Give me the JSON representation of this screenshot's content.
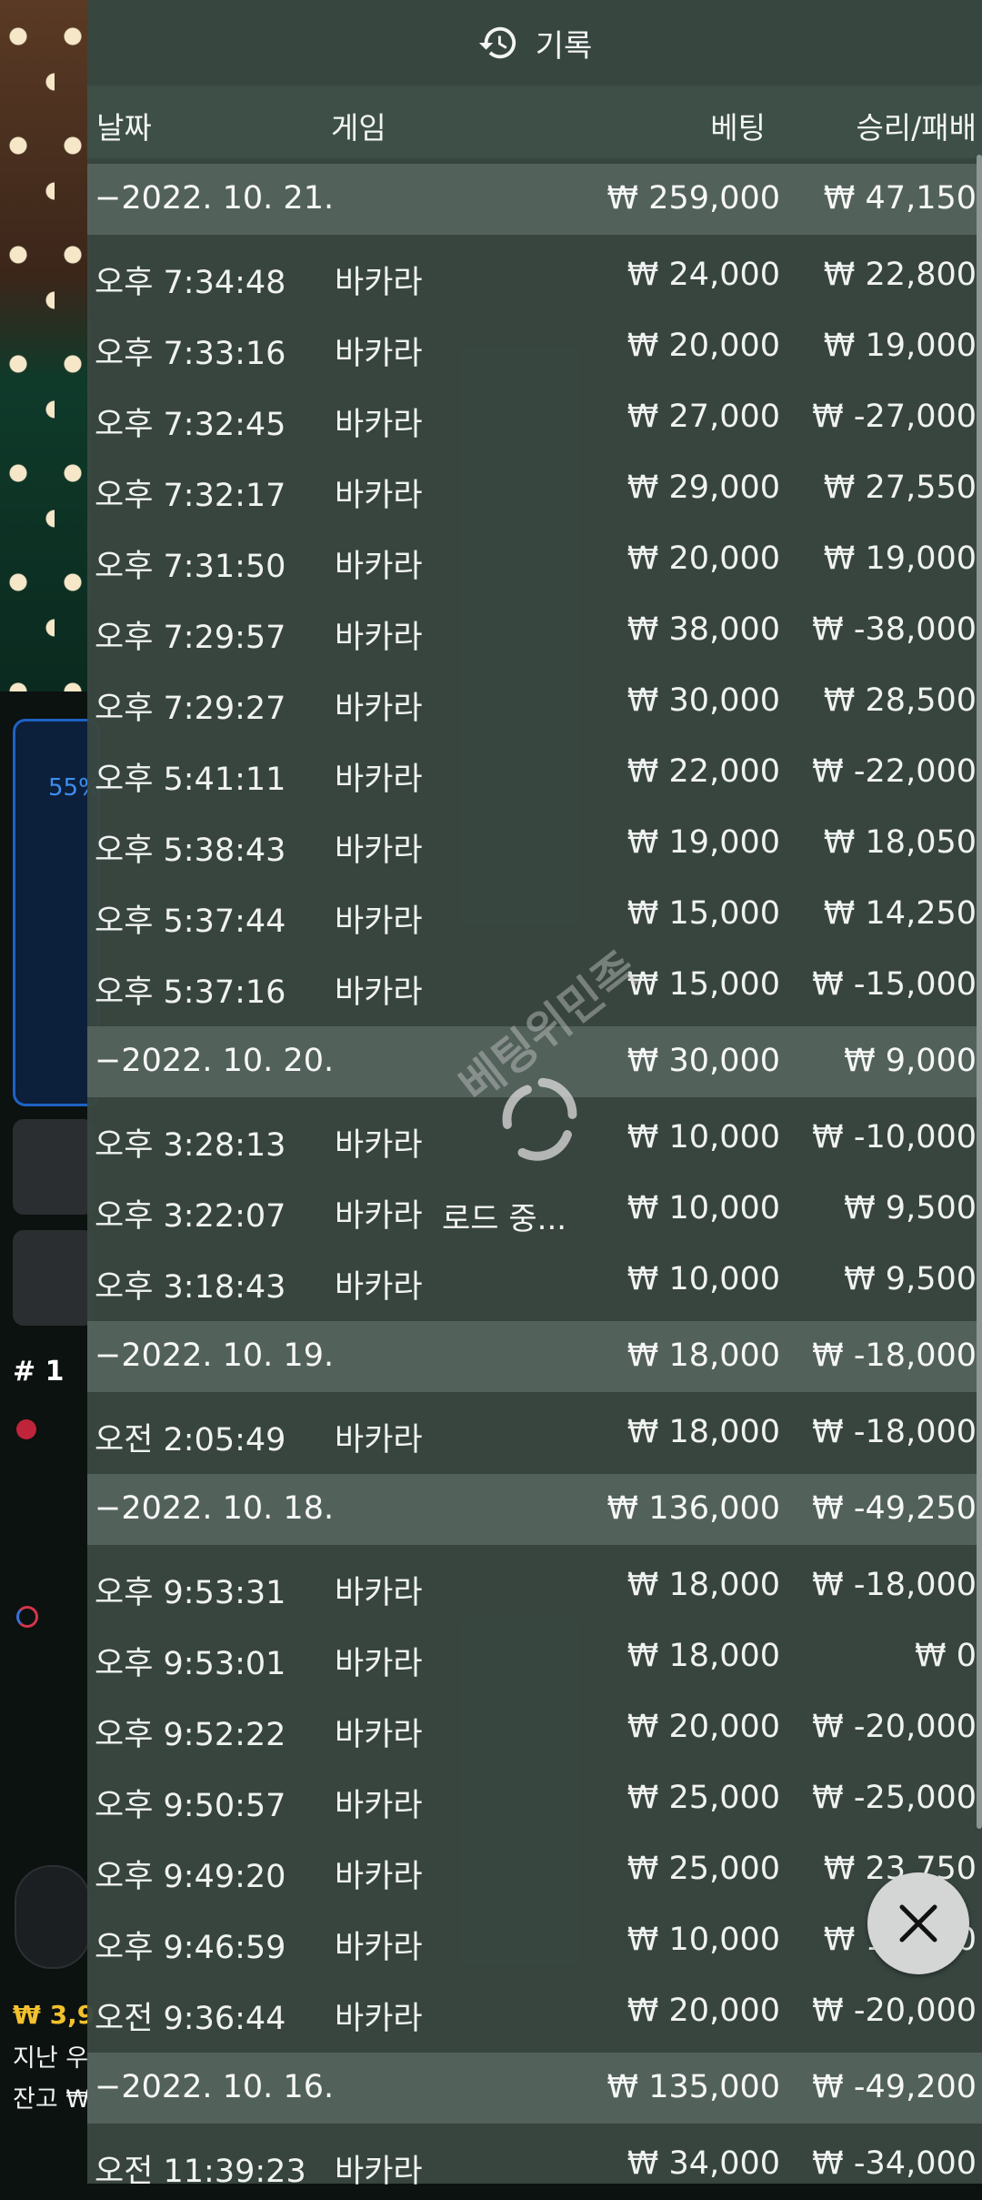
{
  "header": {
    "title": "기록",
    "icon": "history-icon"
  },
  "columns": {
    "date": "날짜",
    "game": "게임",
    "bet": "베팅",
    "result": "승리/패배"
  },
  "groups": [
    {
      "date": "−2022. 10. 21.",
      "bet": "₩ 259,000",
      "result": "₩ 47,150",
      "rows": [
        [
          "오후 7:34:48",
          "바카라",
          "₩ 24,000",
          "₩ 22,800"
        ],
        [
          "오후 7:33:16",
          "바카라",
          "₩ 20,000",
          "₩ 19,000"
        ],
        [
          "오후 7:32:45",
          "바카라",
          "₩ 27,000",
          "₩ -27,000"
        ],
        [
          "오후 7:32:17",
          "바카라",
          "₩ 29,000",
          "₩ 27,550"
        ],
        [
          "오후 7:31:50",
          "바카라",
          "₩ 20,000",
          "₩ 19,000"
        ],
        [
          "오후 7:29:57",
          "바카라",
          "₩ 38,000",
          "₩ -38,000"
        ],
        [
          "오후 7:29:27",
          "바카라",
          "₩ 30,000",
          "₩ 28,500"
        ],
        [
          "오후 5:41:11",
          "바카라",
          "₩ 22,000",
          "₩ -22,000"
        ],
        [
          "오후 5:38:43",
          "바카라",
          "₩ 19,000",
          "₩ 18,050"
        ],
        [
          "오후 5:37:44",
          "바카라",
          "₩ 15,000",
          "₩ 14,250"
        ],
        [
          "오후 5:37:16",
          "바카라",
          "₩ 15,000",
          "₩ -15,000"
        ]
      ]
    },
    {
      "date": "−2022. 10. 20.",
      "bet": "₩ 30,000",
      "result": "₩ 9,000",
      "rows": [
        [
          "오후 3:28:13",
          "바카라",
          "₩ 10,000",
          "₩ -10,000"
        ],
        [
          "오후 3:22:07",
          "바카라",
          "₩ 10,000",
          "₩ 9,500"
        ],
        [
          "오후 3:18:43",
          "바카라",
          "₩ 10,000",
          "₩ 9,500"
        ]
      ]
    },
    {
      "date": "−2022. 10. 19.",
      "bet": "₩ 18,000",
      "result": "₩ -18,000",
      "rows": [
        [
          "오전 2:05:49",
          "바카라",
          "₩ 18,000",
          "₩ -18,000"
        ]
      ]
    },
    {
      "date": "−2022. 10. 18.",
      "bet": "₩ 136,000",
      "result": "₩ -49,250",
      "rows": [
        [
          "오후 9:53:31",
          "바카라",
          "₩ 18,000",
          "₩ -18,000"
        ],
        [
          "오후 9:53:01",
          "바카라",
          "₩ 18,000",
          "₩ 0"
        ],
        [
          "오후 9:52:22",
          "바카라",
          "₩ 20,000",
          "₩ -20,000"
        ],
        [
          "오후 9:50:57",
          "바카라",
          "₩ 25,000",
          "₩ -25,000"
        ],
        [
          "오후 9:49:20",
          "바카라",
          "₩ 25,000",
          "₩ 23,750"
        ],
        [
          "오후 9:46:59",
          "바카라",
          "₩ 10,000",
          "₩ 10,000"
        ],
        [
          "오전 9:36:44",
          "바카라",
          "₩ 20,000",
          "₩ -20,000"
        ]
      ]
    },
    {
      "date": "−2022. 10. 16.",
      "bet": "₩ 135,000",
      "result": "₩ -49,200",
      "rows": [
        [
          "오전 11:39:23",
          "바카라",
          "₩ 34,000",
          "₩ -34,000"
        ]
      ]
    }
  ],
  "loading": {
    "text": "로드 중...",
    "watermark": "베팅위민족"
  },
  "background": {
    "progress_label": "55%",
    "rank": "# 1",
    "balance": "₩ 3,9",
    "line1": "지난 우",
    "line2": "잔고 ₩"
  },
  "close_button": {
    "icon": "close-icon"
  }
}
